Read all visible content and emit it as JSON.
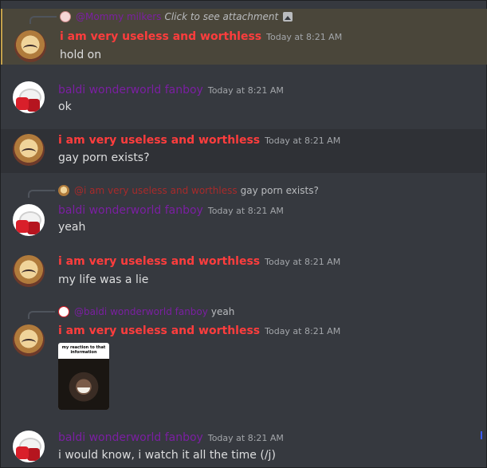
{
  "messages": [
    {
      "reply": {
        "name": "@Mommy milkers",
        "text": "Click to see attachment"
      },
      "author": "i am very useless and worthless",
      "time": "Today at 8:21 AM",
      "text": "hold on"
    },
    {
      "author": "baldi wonderworld fanboy",
      "time": "Today at 8:21 AM",
      "text": "ok"
    },
    {
      "author": "i am very useless and worthless",
      "time": "Today at 8:21 AM",
      "text": "gay porn exists?"
    },
    {
      "reply": {
        "name": "@i am very useless and worthless",
        "text": "gay porn exists?"
      },
      "author": "baldi wonderworld fanboy",
      "time": "Today at 8:21 AM",
      "text": "yeah"
    },
    {
      "author": "i am very useless and worthless",
      "time": "Today at 8:21 AM",
      "text": "my life was a lie"
    },
    {
      "reply": {
        "name": "@baldi wonderworld fanboy",
        "text": "yeah"
      },
      "author": "i am very useless and worthless",
      "time": "Today at 8:21 AM",
      "attachment_caption": "my reaction to that information"
    },
    {
      "author": "baldi wonderworld fanboy",
      "time": "Today at 8:21 AM",
      "text": "i would know, i watch it all the time (/j)"
    }
  ],
  "colors": {
    "background": "#36393f",
    "highlight": "#4a463a",
    "author_red": "#ff3d3d",
    "author_purple": "#7b1fa2"
  }
}
